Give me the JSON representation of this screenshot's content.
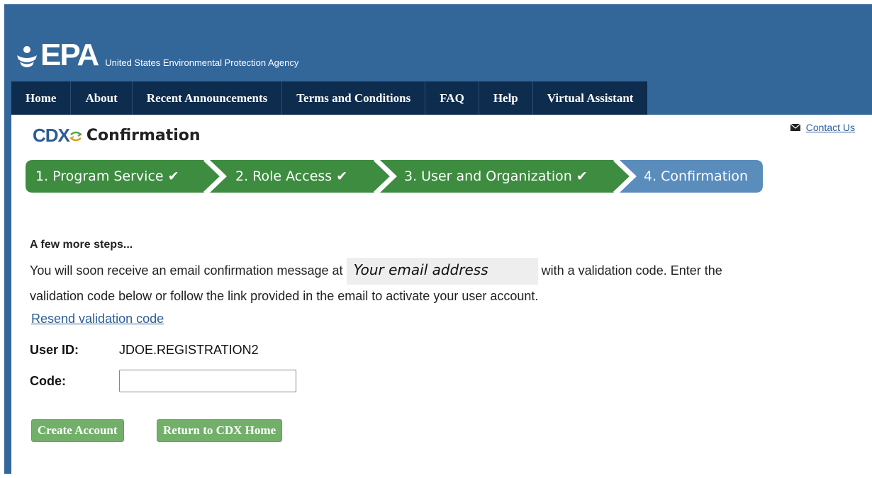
{
  "header": {
    "logo_text": "EPA",
    "agency_name": "United States Environmental Protection Agency"
  },
  "nav": {
    "items": [
      {
        "label": "Home"
      },
      {
        "label": "About"
      },
      {
        "label": "Recent Announcements"
      },
      {
        "label": "Terms and Conditions"
      },
      {
        "label": "FAQ"
      },
      {
        "label": "Help"
      },
      {
        "label": "Virtual Assistant"
      }
    ]
  },
  "contact": {
    "label": "Contact Us",
    "icon": "envelope-icon"
  },
  "page": {
    "logo_text": "CDX",
    "title": "Confirmation"
  },
  "steps": [
    {
      "label": "1. Program Service",
      "done": true
    },
    {
      "label": "2. Role Access",
      "done": true
    },
    {
      "label": "3. User and Organization",
      "done": true
    },
    {
      "label": "4. Confirmation",
      "done": false
    }
  ],
  "colors": {
    "brand_blue": "#336699",
    "nav_dark": "#0e2c4d",
    "step_done": "#3d8c40",
    "step_current": "#5a8cbc",
    "button_green": "#72b06a",
    "link_blue": "#2a5d96"
  },
  "message": {
    "heading": "A few more steps...",
    "line1_before": "You will soon receive an email confirmation message at",
    "email_placeholder": "Your email address",
    "line1_after": "with a validation code. Enter the",
    "line2": "validation code below or follow the link provided in the email to activate your user account.",
    "resend_link": "Resend validation code"
  },
  "form": {
    "user_id_label": "User ID:",
    "user_id_value": "JDOE.REGISTRATION2",
    "code_label": "Code:",
    "code_value": ""
  },
  "buttons": {
    "create": "Create Account",
    "return": "Return to CDX Home"
  }
}
